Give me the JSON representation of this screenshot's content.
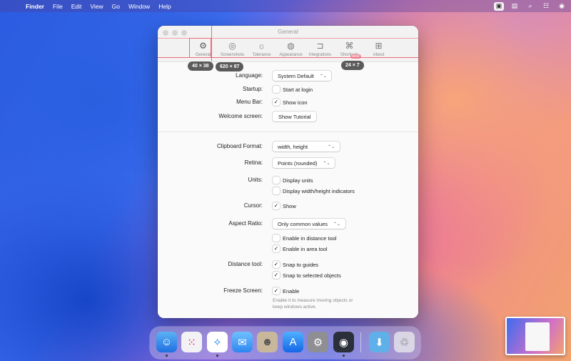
{
  "menubar": {
    "app": "Finder",
    "items": [
      "File",
      "Edit",
      "View",
      "Go",
      "Window",
      "Help"
    ]
  },
  "window": {
    "title": "General",
    "tabs": [
      {
        "label": "General",
        "icon": "gear-icon"
      },
      {
        "label": "Screenshots",
        "icon": "camera-icon"
      },
      {
        "label": "Tolerance",
        "icon": "sun-icon"
      },
      {
        "label": "Appearance",
        "icon": "palette-icon"
      },
      {
        "label": "Integrations",
        "icon": "plug-icon"
      },
      {
        "label": "Shortcuts",
        "icon": "command-icon",
        "badge": "NEW"
      },
      {
        "label": "About",
        "icon": "grid-icon"
      }
    ]
  },
  "overlay": {
    "size_tab": "40 × 38",
    "size_window": "620 × 87",
    "size_gap": "24 × 7"
  },
  "settings": {
    "language": {
      "label": "Language:",
      "value": "System Default"
    },
    "startup": {
      "label": "Startup:",
      "option": "Start at login",
      "checked": false
    },
    "menubar": {
      "label": "Menu Bar:",
      "option": "Show icon",
      "checked": true
    },
    "welcome": {
      "label": "Welcome screen:",
      "button": "Show Tutorial"
    },
    "clipboard": {
      "label": "Clipboard Format:",
      "value": "width, height"
    },
    "retina": {
      "label": "Retina:",
      "value": "Points (rounded)"
    },
    "units": {
      "label": "Units:",
      "option1": "Display units",
      "option2": "Display width/height indicators"
    },
    "cursor": {
      "label": "Cursor:",
      "option": "Show",
      "checked": true
    },
    "aspect": {
      "label": "Aspect Ratio:",
      "value": "Only common values",
      "option1": "Enable in distance tool",
      "option2": "Enable in area tool"
    },
    "distance": {
      "label": "Distance tool:",
      "option1": "Snap to guides",
      "option2": "Snap to selected objects"
    },
    "freeze": {
      "label": "Freeze Screen:",
      "option": "Enable",
      "note": "Enable it to measure moving objects or keep windows active."
    }
  },
  "dock": {
    "apps": [
      "finder",
      "launchpad",
      "safari",
      "mail",
      "contacts",
      "app-store",
      "system-settings",
      "ruler-app",
      "downloads-folder",
      "trash"
    ]
  },
  "colors": {
    "measure": "#ee6a7a",
    "label_bg": "#5b5b5b"
  }
}
